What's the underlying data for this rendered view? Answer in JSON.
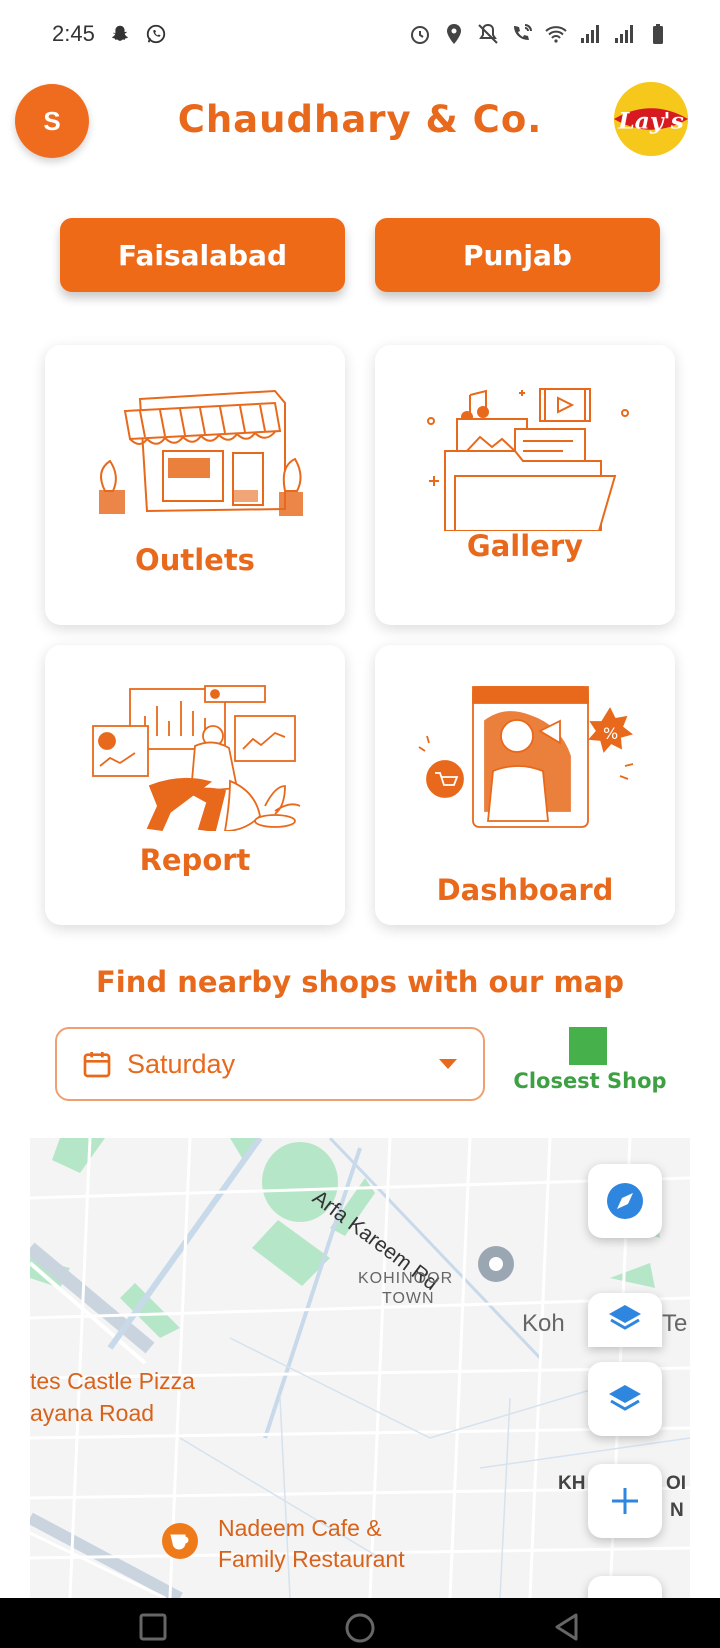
{
  "status_bar": {
    "time": "2:45",
    "left_icons": [
      "snapchat-icon",
      "whatsapp-icon"
    ],
    "right_icons": [
      "alarm-icon",
      "location-icon",
      "mute-icon",
      "wifi-call-icon",
      "wifi-icon",
      "signal-icon",
      "signal-icon",
      "battery-icon"
    ]
  },
  "header": {
    "avatar_initial": "S",
    "title": "Chaudhary & Co.",
    "brand_logo_text": "Lay's"
  },
  "location": {
    "city": "Faisalabad",
    "state": "Punjab"
  },
  "cards": {
    "outlets": "Outlets",
    "gallery": "Gallery",
    "report": "Report",
    "dashboard": "Dashboard"
  },
  "map_section": {
    "heading": "Find nearby shops with our map",
    "day_select": {
      "value": "Saturday"
    },
    "legend": {
      "label": "Closest Shop",
      "color": "#46b04a"
    }
  },
  "map": {
    "labels": {
      "road": "Arfa Kareem Rd",
      "area": "KOHINOOR",
      "area2": "TOWN",
      "place_partial": "Koh",
      "place_partial2": "Te",
      "pizza_line1": "tes Castle Pizza",
      "pizza_line2": "ayana Road",
      "partial_k": "KH",
      "partial_oi": "OI",
      "partial_n": "N",
      "cafe_line1": "Nadeem Cafe &",
      "cafe_line2": "Family Restaurant"
    },
    "controls": [
      "compass-icon",
      "layers-icon",
      "layers-icon",
      "zoom-in-icon"
    ]
  },
  "colors": {
    "primary": "#ee6a17",
    "accent_text": "#e8691b",
    "legend_green": "#46b04a",
    "map_blue": "#2f86de"
  }
}
